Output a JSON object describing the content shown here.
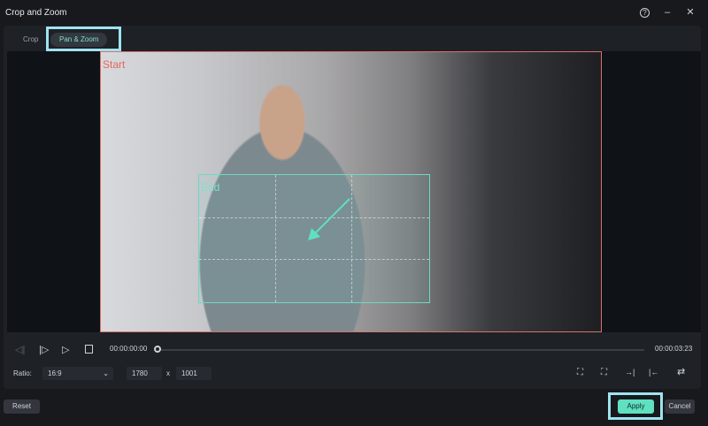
{
  "window": {
    "title": "Crop and Zoom",
    "help": "?",
    "minimize": "–",
    "close": "✕"
  },
  "tabs": [
    {
      "label": "Crop",
      "active": false
    },
    {
      "label": "Pan & Zoom",
      "active": true
    }
  ],
  "preview": {
    "start_label": "Start",
    "end_label": "End"
  },
  "playback": {
    "current_time": "00:00:00:00",
    "total_time": "00:00:03:23",
    "progress": 0
  },
  "ratio": {
    "label": "Ratio:",
    "value": "16:9",
    "width": "1780",
    "x": "x",
    "height": "1001"
  },
  "buttons": {
    "reset": "Reset",
    "apply": "Apply",
    "cancel": "Cancel"
  },
  "colors": {
    "accent": "#5fe0c0",
    "start": "#e2675f",
    "end": "#6fd8c3"
  }
}
